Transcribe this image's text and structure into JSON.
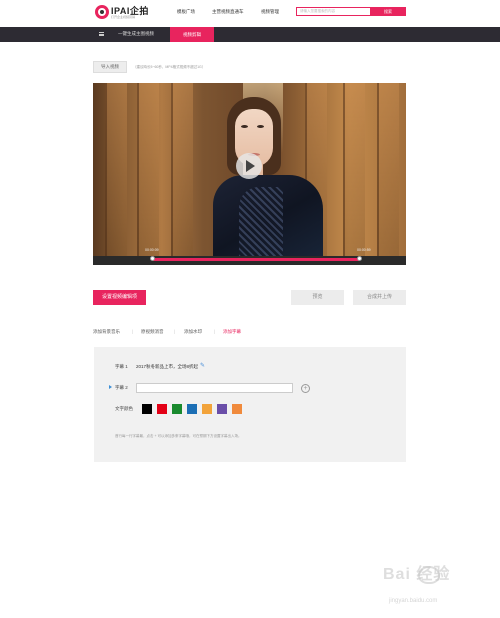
{
  "header": {
    "logo_text": "IPAI企拍",
    "logo_tagline": "打开企业视频营销",
    "nav": [
      "模板广场",
      "主营视频直通车",
      "视频管理"
    ],
    "search": {
      "placeholder": "请输入您要搜索的内容",
      "button_label": "搜索"
    }
  },
  "darkbar": {
    "title": "一键生成主图视频",
    "active_tab": "视频剪辑"
  },
  "import": {
    "button_label": "导入视频",
    "hint": "（建议時长5~60秒，MP4格式视频不超过1G）"
  },
  "player": {
    "time_start": "00:00:09",
    "time_end": "00:00:59",
    "progress": 0.85
  },
  "actions": {
    "primary": "设置视频编辑项",
    "preview": "预览",
    "publish": "合成并上传"
  },
  "tabs": [
    {
      "label": "添加背景音乐",
      "active": false
    },
    {
      "label": "原视频消音",
      "active": false
    },
    {
      "label": "添加水印",
      "active": false
    },
    {
      "label": "添加字幕",
      "active": true
    }
  ],
  "subtitles": {
    "row1_label": "字幕 1",
    "row1_value": "2017秋冬新品上市，全场8折起",
    "row2_label": "字幕 2",
    "row2_value": "",
    "color_label": "文字颜色",
    "colors": [
      "#000000",
      "#e30016",
      "#1a8a2e",
      "#1c6fb5",
      "#f2a33a",
      "#6a4ea8",
      "#f08a3c"
    ],
    "tip": "首行每一行字幕最，点击 + 可以添加多条字幕哦，可在预期下方设置字幕出入场。"
  },
  "watermark": {
    "text": "Bai 经验",
    "url": "jingyan.baidu.com"
  }
}
